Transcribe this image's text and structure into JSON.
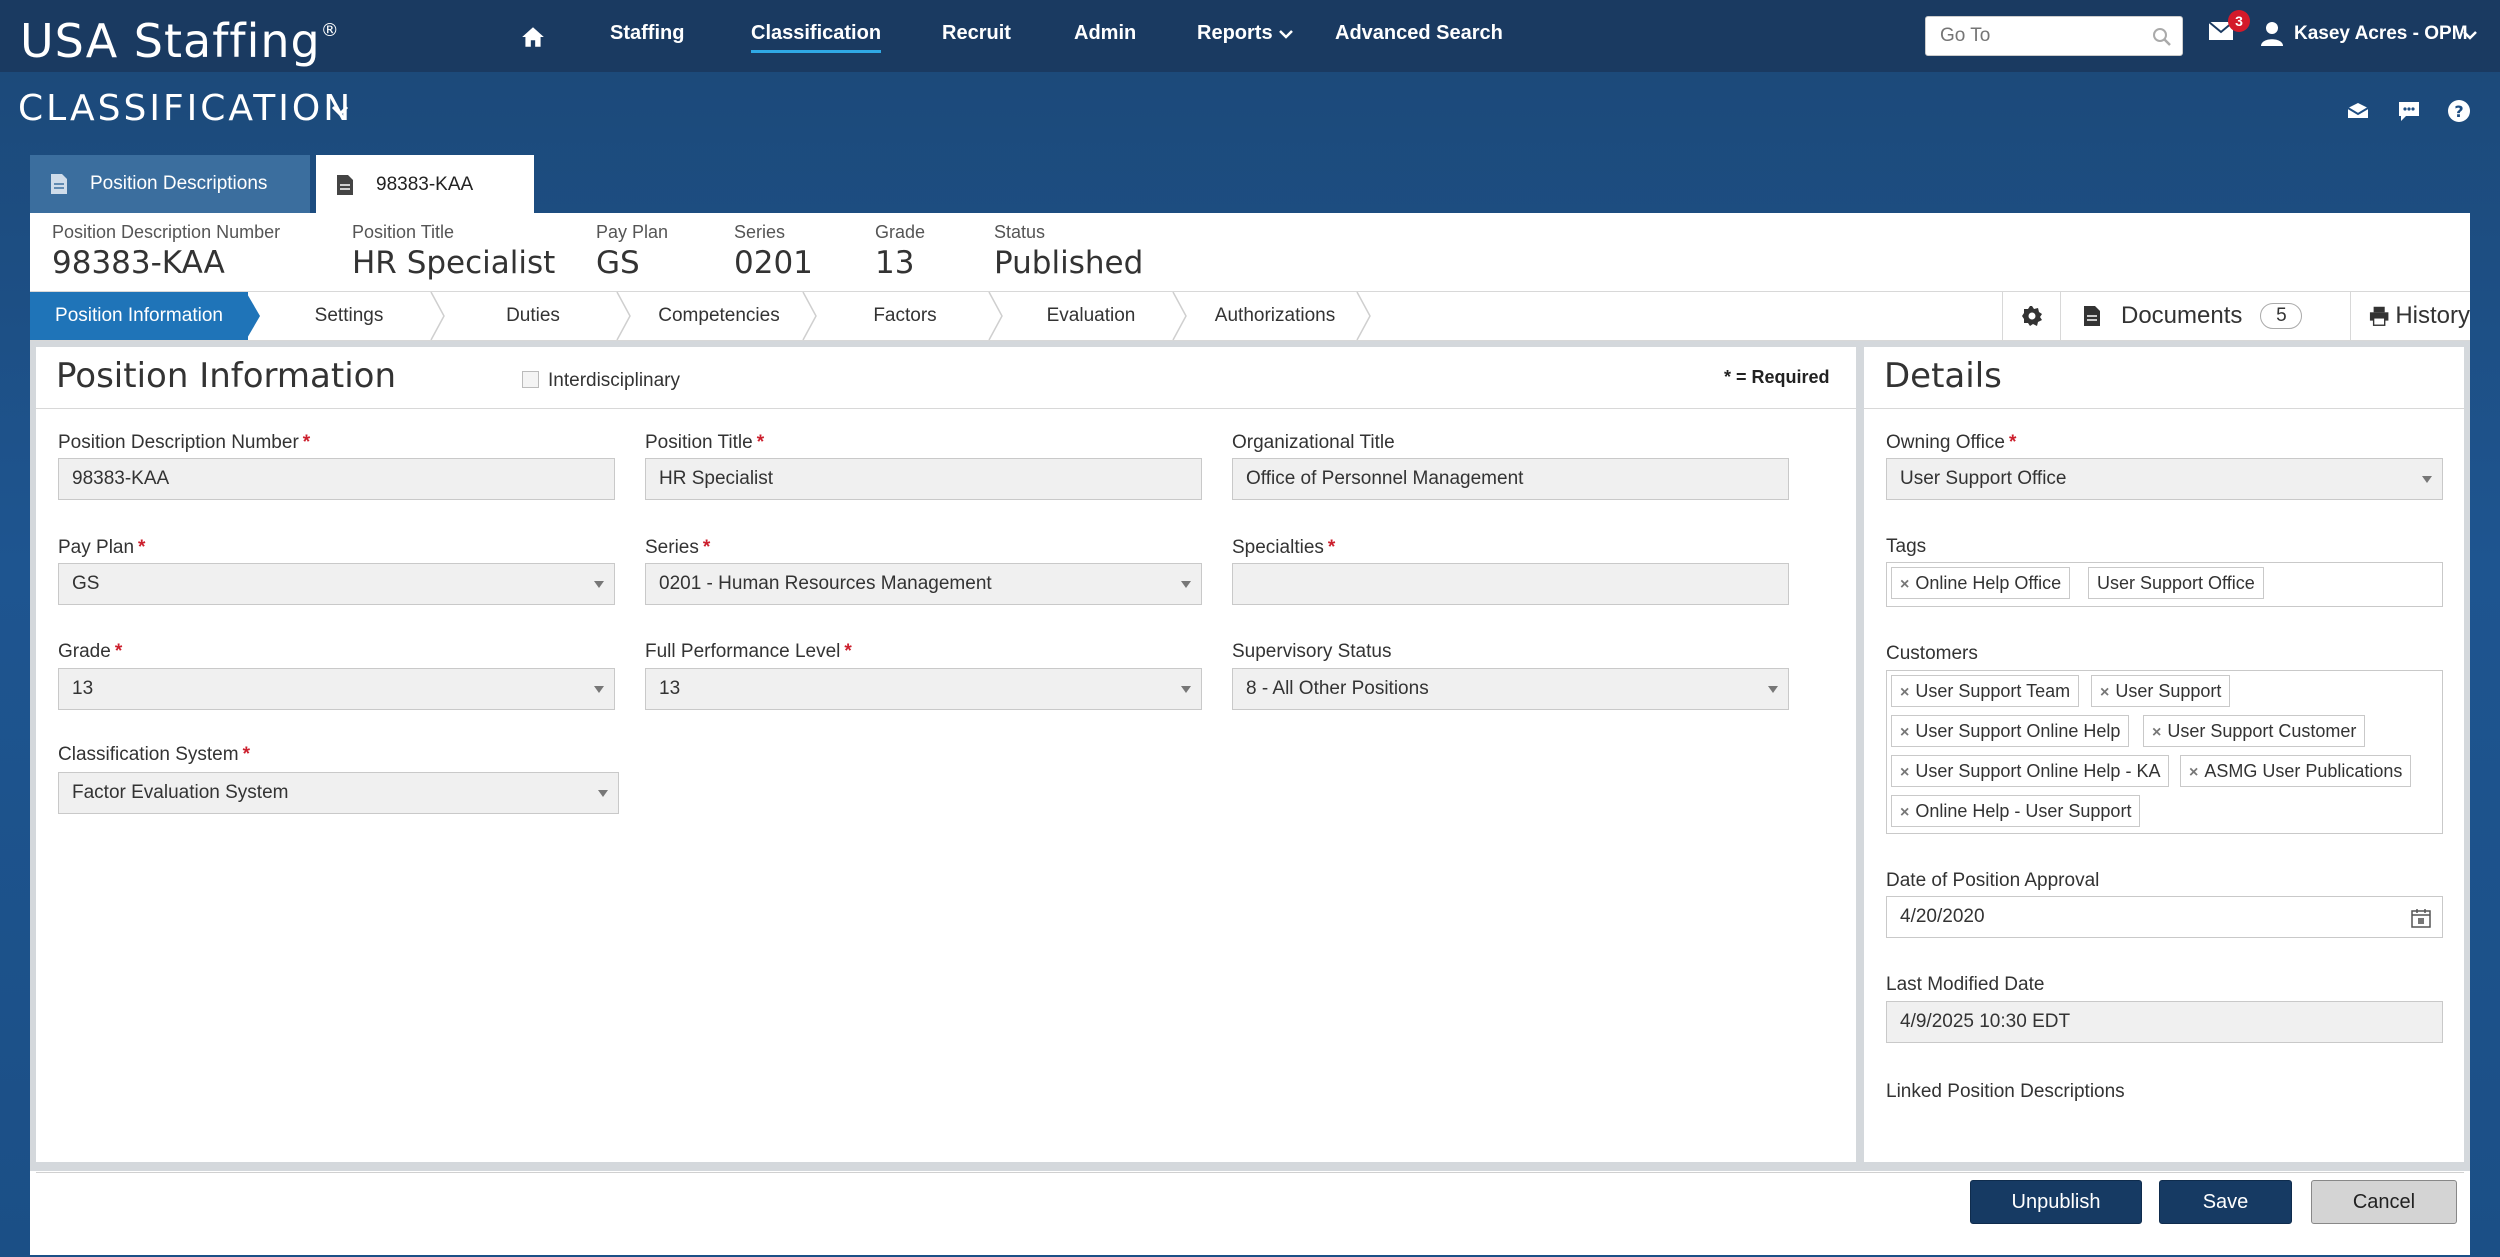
{
  "app": {
    "logo": "USA Staffing",
    "reg_mark": "®"
  },
  "nav": {
    "items": [
      "Staffing",
      "Classification",
      "Recruit",
      "Admin",
      "Reports",
      "Advanced Search"
    ],
    "goto_placeholder": "Go To",
    "mail_count": "3",
    "user": "Kasey Acres - OPM"
  },
  "module": {
    "title": "CLASSIFICATION"
  },
  "tabs": {
    "list": "Position Descriptions",
    "current": "98383-KAA"
  },
  "summary": {
    "pd_number_label": "Position Description Number",
    "pd_number": "98383-KAA",
    "title_label": "Position Title",
    "title": "HR Specialist",
    "payplan_label": "Pay Plan",
    "payplan": "GS",
    "series_label": "Series",
    "series": "0201",
    "grade_label": "Grade",
    "grade": "13",
    "status_label": "Status",
    "status": "Published"
  },
  "steps": [
    "Position Information",
    "Settings",
    "Duties",
    "Competencies",
    "Factors",
    "Evaluation",
    "Authorizations"
  ],
  "tools": {
    "documents": "Documents",
    "documents_count": "5",
    "history": "History"
  },
  "position_info": {
    "title": "Position Information",
    "interdisciplinary": "Interdisciplinary",
    "required_note": "* = Required",
    "fields": {
      "pd_number": {
        "label": "Position Description Number",
        "value": "98383-KAA"
      },
      "position_title": {
        "label": "Position Title",
        "value": "HR Specialist"
      },
      "org_title": {
        "label": "Organizational Title",
        "value": "Office of Personnel Management"
      },
      "pay_plan": {
        "label": "Pay Plan",
        "value": "GS"
      },
      "series": {
        "label": "Series",
        "value": "0201 - Human Resources Management"
      },
      "specialties": {
        "label": "Specialties",
        "value": ""
      },
      "grade": {
        "label": "Grade",
        "value": "13"
      },
      "fpl": {
        "label": "Full Performance Level",
        "value": "13"
      },
      "supervisory": {
        "label": "Supervisory Status",
        "value": "8 - All Other Positions"
      },
      "class_system": {
        "label": "Classification System",
        "value": "Factor Evaluation System"
      }
    }
  },
  "details": {
    "title": "Details",
    "owning_office_label": "Owning Office",
    "owning_office": "User Support Office",
    "tags_label": "Tags",
    "tags": [
      "Online Help Office",
      "User Support Office"
    ],
    "customers_label": "Customers",
    "customers": [
      "User Support Team",
      "User Support",
      "User Support Online Help",
      "User Support Customer",
      "User Support Online Help - KA",
      "ASMG User Publications",
      "Online Help - User Support"
    ],
    "approval_label": "Date of Position Approval",
    "approval": "4/20/2020",
    "modified_label": "Last Modified Date",
    "modified": "4/9/2025 10:30 EDT",
    "linked_label": "Linked Position Descriptions"
  },
  "footer": {
    "unpublish": "Unpublish",
    "save": "Save",
    "cancel": "Cancel"
  },
  "colors": {
    "nav_bg": "#1a3a61",
    "active_step": "#1f74b8",
    "required": "#cc1f2d",
    "badge": "#d41a2a",
    "primary_btn": "#163a63"
  }
}
